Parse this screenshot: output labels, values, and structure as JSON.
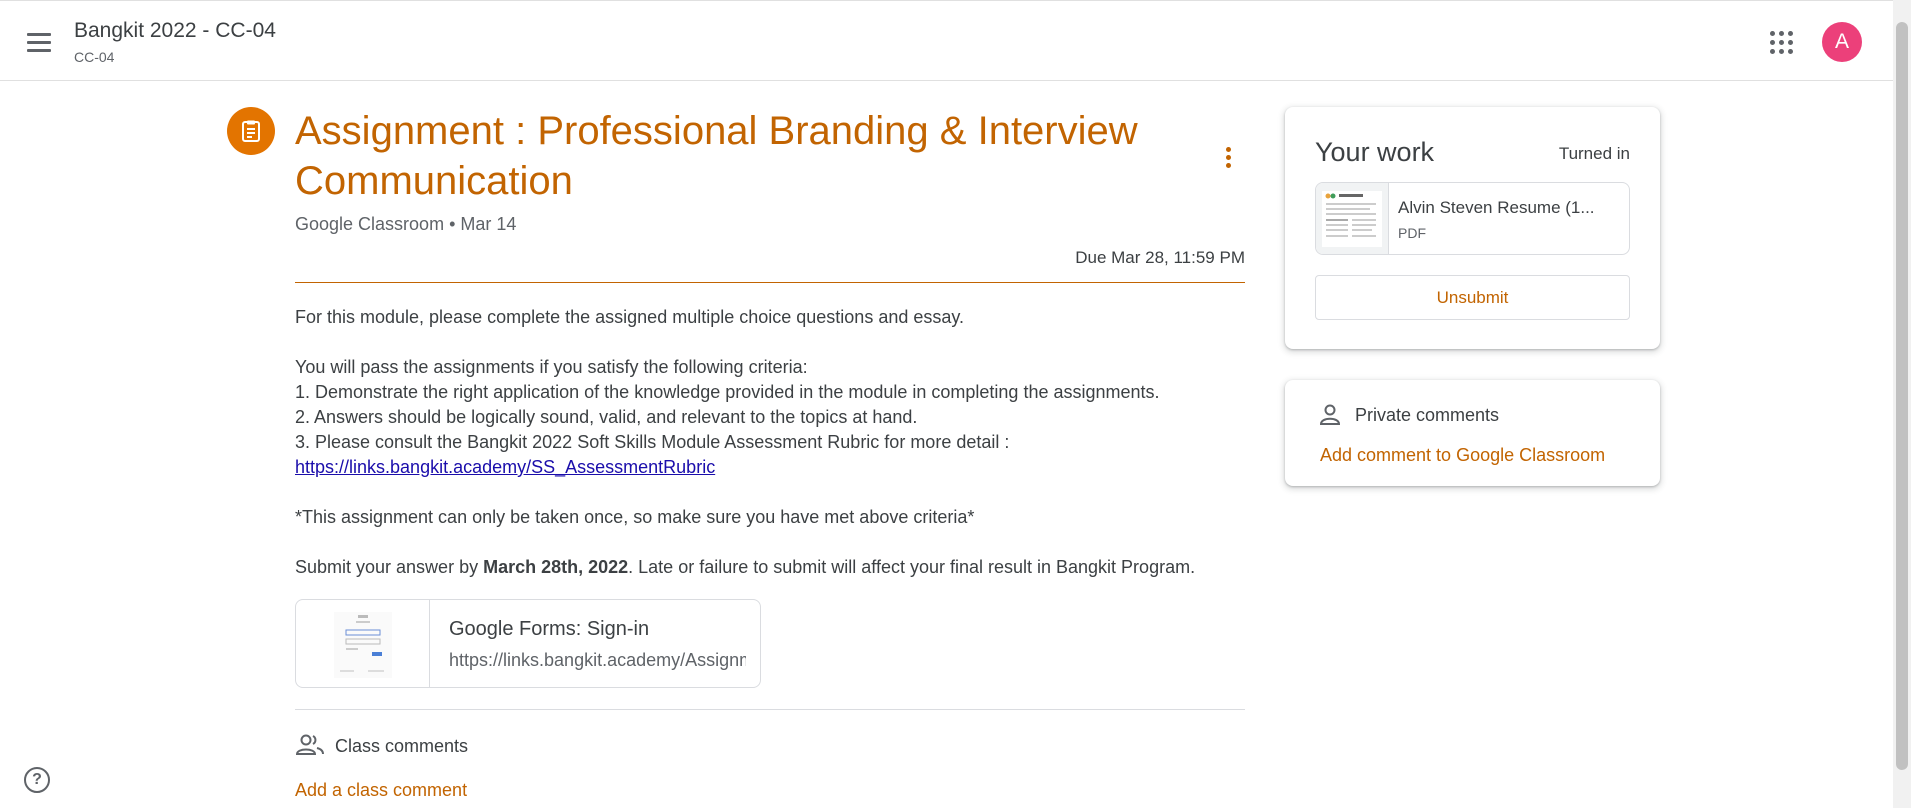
{
  "header": {
    "class_title": "Bangkit 2022 - CC-04",
    "class_section": "CC-04",
    "avatar_letter": "A",
    "avatar_color": "#ec407a"
  },
  "assignment": {
    "title": "Assignment : Professional Branding & Interview Communication",
    "author": "Google Classroom",
    "date": "Mar 14",
    "due": "Due Mar 28, 11:59 PM",
    "accent_color": "#c26401",
    "icon_color": "#e37400",
    "description": {
      "intro": "For this module, please complete the assigned multiple choice questions and essay.",
      "criteria_intro": "You will pass the assignments if you satisfy the following criteria:",
      "criteria": [
        "1. Demonstrate the right application of the knowledge provided in the module in completing the assignments.",
        "2. Answers should be logically sound, valid, and relevant to the topics at hand.",
        "3. Please consult the Bangkit 2022 Soft Skills Module Assessment Rubric for more detail :"
      ],
      "rubric_link": "https://links.bangkit.academy/SS_AssessmentRubric",
      "note": "*This assignment can only be taken once, so make sure you have met above criteria*",
      "submit_prefix": "Submit your answer by ",
      "submit_date": "March 28th, 2022",
      "submit_suffix": ". Late or failure to submit will affect your final result in Bangkit Program."
    },
    "attachment": {
      "title": "Google Forms: Sign-in",
      "url": "https://links.bangkit.academy/Assignment"
    }
  },
  "class_comments": {
    "label": "Class comments",
    "add_label": "Add a class comment"
  },
  "your_work": {
    "title": "Your work",
    "status": "Turned in",
    "file_name": "Alvin Steven Resume (1...",
    "file_type": "PDF",
    "unsubmit_label": "Unsubmit"
  },
  "private_comments": {
    "label": "Private comments",
    "add_label": "Add comment to Google Classroom"
  },
  "help_label": "?"
}
